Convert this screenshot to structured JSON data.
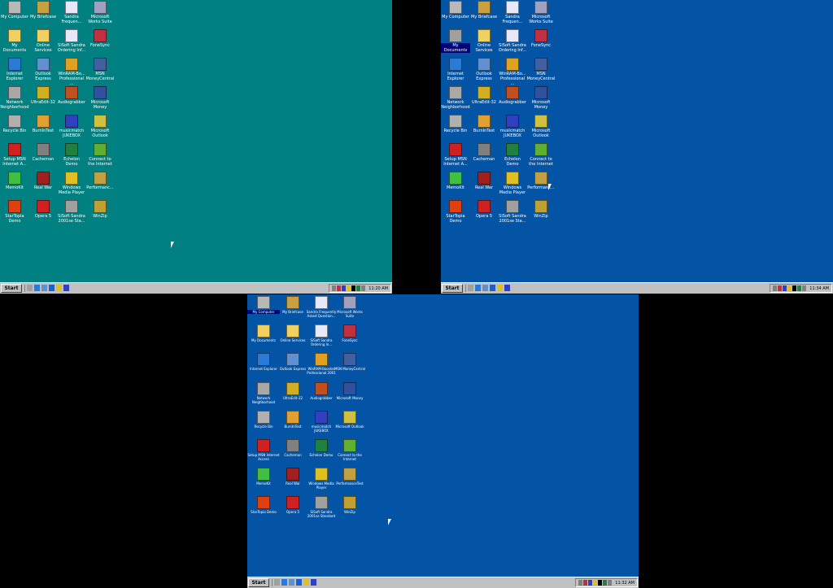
{
  "screens": [
    {
      "clock": "11:20 AM",
      "start_label": "Start",
      "icons": [
        {
          "label": "My Computer",
          "icon": "computer-icon",
          "color": "#b8b8b8"
        },
        {
          "label": "My Briefcase",
          "icon": "briefcase-icon",
          "color": "#c8a040"
        },
        {
          "label": "Sandra Frequen...",
          "icon": "document-icon",
          "color": "#e8e8f8"
        },
        {
          "label": "Microsoft Works Suite",
          "icon": "works-icon",
          "color": "#a0a0c0"
        },
        {
          "label": "My Documents",
          "icon": "folder-icon",
          "color": "#f0d060"
        },
        {
          "label": "Online Services",
          "icon": "folder-icon",
          "color": "#f0d060"
        },
        {
          "label": "SiSoft Sandra Ordering Inf...",
          "icon": "document-icon",
          "color": "#e8e8f8"
        },
        {
          "label": "FoneSync",
          "icon": "fonesync-icon",
          "color": "#c03040"
        },
        {
          "label": "Internet Explorer",
          "icon": "ie-icon",
          "color": "#2a7ad8"
        },
        {
          "label": "Outlook Express",
          "icon": "outlook-express-icon",
          "color": "#6090d0"
        },
        {
          "label": "WinRAM-Bo... Professional ...",
          "icon": "winram-icon",
          "color": "#e0a020"
        },
        {
          "label": "MSN MoneyCentral",
          "icon": "msn-money-icon",
          "color": "#4060a0"
        },
        {
          "label": "Network Neighborhood",
          "icon": "network-icon",
          "color": "#a8a8a8"
        },
        {
          "label": "UltraEdit-32",
          "icon": "ultraedit-icon",
          "color": "#d0b020"
        },
        {
          "label": "Audiograbber",
          "icon": "audiograbber-icon",
          "color": "#c05020"
        },
        {
          "label": "Microsoft Money",
          "icon": "money-icon",
          "color": "#3050a0"
        },
        {
          "label": "Recycle Bin",
          "icon": "recycle-bin-icon",
          "color": "#b0b0b0"
        },
        {
          "label": "BurnInTest",
          "icon": "burnintest-icon",
          "color": "#e0a030"
        },
        {
          "label": "musicmatch JUKEBOX",
          "icon": "musicmatch-icon",
          "color": "#3040c0"
        },
        {
          "label": "Microsoft Outlook",
          "icon": "outlook-icon",
          "color": "#d0c040"
        },
        {
          "label": "Setup MSN Internet A...",
          "icon": "msn-icon",
          "color": "#d02020"
        },
        {
          "label": "Cacheman",
          "icon": "cacheman-icon",
          "color": "#808080"
        },
        {
          "label": "Echelon Demo",
          "icon": "echelon-icon",
          "color": "#208040"
        },
        {
          "label": "Connect to the Internet",
          "icon": "connect-icon",
          "color": "#60b030"
        },
        {
          "label": "MemoKit",
          "icon": "memokit-icon",
          "color": "#40c040"
        },
        {
          "label": "Real War",
          "icon": "realwar-icon",
          "color": "#a02020"
        },
        {
          "label": "Windows Media Player",
          "icon": "media-player-icon",
          "color": "#e0c020"
        },
        {
          "label": "Performanc...",
          "icon": "performance-icon",
          "color": "#c0a040"
        },
        {
          "label": "StarTopia Demo",
          "icon": "startopia-icon",
          "color": "#e04010"
        },
        {
          "label": "Opera 5",
          "icon": "opera-icon",
          "color": "#d02020"
        },
        {
          "label": "SiSoft Sandra 2001se Sta...",
          "icon": "sandra-icon",
          "color": "#a0a0a0"
        },
        {
          "label": "WinZip",
          "icon": "winzip-icon",
          "color": "#c0a030"
        }
      ]
    },
    {
      "clock": "11:34 AM",
      "start_label": "Start",
      "icons": [
        {
          "label": "My Computer",
          "icon": "computer-icon",
          "color": "#b8b8b8"
        },
        {
          "label": "My Briefcase",
          "icon": "briefcase-icon",
          "color": "#c8a040"
        },
        {
          "label": "Sandra Frequen...",
          "icon": "document-icon",
          "color": "#e8e8f8"
        },
        {
          "label": "Microsoft Works Suite",
          "icon": "works-icon",
          "color": "#a0a0c0"
        },
        {
          "label": "My Documents",
          "icon": "folder-icon",
          "color": "#a0a0a0",
          "selected": true
        },
        {
          "label": "Online Services",
          "icon": "folder-icon",
          "color": "#f0d060"
        },
        {
          "label": "SiSoft Sandra Ordering Inf...",
          "icon": "document-icon",
          "color": "#e8e8f8"
        },
        {
          "label": "FoneSync",
          "icon": "fonesync-icon",
          "color": "#c03040"
        },
        {
          "label": "Internet Explorer",
          "icon": "ie-icon",
          "color": "#2a7ad8"
        },
        {
          "label": "Outlook Express",
          "icon": "outlook-express-icon",
          "color": "#6090d0"
        },
        {
          "label": "WinRAM-Bo... Professional ...",
          "icon": "winram-icon",
          "color": "#e0a020"
        },
        {
          "label": "MSN MoneyCentral",
          "icon": "msn-money-icon",
          "color": "#4060a0"
        },
        {
          "label": "Network Neighborhood",
          "icon": "network-icon",
          "color": "#a8a8a8"
        },
        {
          "label": "UltraEdit-32",
          "icon": "ultraedit-icon",
          "color": "#d0b020"
        },
        {
          "label": "Audiograbber",
          "icon": "audiograbber-icon",
          "color": "#c05020"
        },
        {
          "label": "Microsoft Money",
          "icon": "money-icon",
          "color": "#3050a0"
        },
        {
          "label": "Recycle Bin",
          "icon": "recycle-bin-icon",
          "color": "#b0b0b0"
        },
        {
          "label": "BurnInTest",
          "icon": "burnintest-icon",
          "color": "#e0a030"
        },
        {
          "label": "musicmatch JUKEBOX",
          "icon": "musicmatch-icon",
          "color": "#3040c0"
        },
        {
          "label": "Microsoft Outlook",
          "icon": "outlook-icon",
          "color": "#d0c040"
        },
        {
          "label": "Setup MSN Internet A...",
          "icon": "msn-icon",
          "color": "#d02020"
        },
        {
          "label": "Cacheman",
          "icon": "cacheman-icon",
          "color": "#808080"
        },
        {
          "label": "Echelon Demo",
          "icon": "echelon-icon",
          "color": "#208040"
        },
        {
          "label": "Connect to the Internet",
          "icon": "connect-icon",
          "color": "#60b030"
        },
        {
          "label": "MemoKit",
          "icon": "memokit-icon",
          "color": "#40c040"
        },
        {
          "label": "Real War",
          "icon": "realwar-icon",
          "color": "#a02020"
        },
        {
          "label": "Windows Media Player",
          "icon": "media-player-icon",
          "color": "#e0c020"
        },
        {
          "label": "Performanc...",
          "icon": "performance-icon",
          "color": "#c0a040"
        },
        {
          "label": "StarTopia Demo",
          "icon": "startopia-icon",
          "color": "#e04010"
        },
        {
          "label": "Opera 5",
          "icon": "opera-icon",
          "color": "#d02020"
        },
        {
          "label": "SiSoft Sandra 2001se Sta...",
          "icon": "sandra-icon",
          "color": "#a0a0a0"
        },
        {
          "label": "WinZip",
          "icon": "winzip-icon",
          "color": "#c0a030"
        }
      ]
    },
    {
      "clock": "11:32 AM",
      "start_label": "Start",
      "icons": [
        {
          "label": "My Computer",
          "icon": "computer-icon",
          "color": "#b8b8b8",
          "selected": true
        },
        {
          "label": "My Briefcase",
          "icon": "briefcase-icon",
          "color": "#c8a040"
        },
        {
          "label": "Sandra Frequently Asked Question...",
          "icon": "document-icon",
          "color": "#e8e8f8"
        },
        {
          "label": "Microsoft Works Suite",
          "icon": "works-icon",
          "color": "#a0a0c0"
        },
        {
          "label": "My Documents",
          "icon": "folder-icon",
          "color": "#f0d060"
        },
        {
          "label": "Online Services",
          "icon": "folder-icon",
          "color": "#f0d060"
        },
        {
          "label": "SiSoft Sandra Ordering In...",
          "icon": "document-icon",
          "color": "#e8e8f8"
        },
        {
          "label": "FoneSync",
          "icon": "fonesync-icon",
          "color": "#c03040"
        },
        {
          "label": "Internet Explorer",
          "icon": "ie-icon",
          "color": "#2a7ad8"
        },
        {
          "label": "Outlook Express",
          "icon": "outlook-express-icon",
          "color": "#6090d0"
        },
        {
          "label": "WinRAM-Booster Professional 2001",
          "icon": "winram-icon",
          "color": "#e0a020"
        },
        {
          "label": "MSN MoneyCentral",
          "icon": "msn-money-icon",
          "color": "#4060a0"
        },
        {
          "label": "Network Neighborhood",
          "icon": "network-icon",
          "color": "#a8a8a8"
        },
        {
          "label": "UltraEdit-32",
          "icon": "ultraedit-icon",
          "color": "#d0b020"
        },
        {
          "label": "Audiograbber",
          "icon": "audiograbber-icon",
          "color": "#c05020"
        },
        {
          "label": "Microsoft Money",
          "icon": "money-icon",
          "color": "#3050a0"
        },
        {
          "label": "Recycle Bin",
          "icon": "recycle-bin-icon",
          "color": "#b0b0b0"
        },
        {
          "label": "BurnInTest",
          "icon": "burnintest-icon",
          "color": "#e0a030"
        },
        {
          "label": "musicmatch JUKEBOX",
          "icon": "musicmatch-icon",
          "color": "#3040c0"
        },
        {
          "label": "Microsoft Outlook",
          "icon": "outlook-icon",
          "color": "#d0c040"
        },
        {
          "label": "Setup MSN Internet Access",
          "icon": "msn-icon",
          "color": "#d02020"
        },
        {
          "label": "Cacheman",
          "icon": "cacheman-icon",
          "color": "#808080"
        },
        {
          "label": "Echelon Demo",
          "icon": "echelon-icon",
          "color": "#208040"
        },
        {
          "label": "Connect to the Internet",
          "icon": "connect-icon",
          "color": "#60b030"
        },
        {
          "label": "MemoKit",
          "icon": "memokit-icon",
          "color": "#40c040"
        },
        {
          "label": "Real War",
          "icon": "realwar-icon",
          "color": "#a02020"
        },
        {
          "label": "Windows Media Player",
          "icon": "media-player-icon",
          "color": "#e0c020"
        },
        {
          "label": "PerformanceTest",
          "icon": "performance-icon",
          "color": "#c0a040"
        },
        {
          "label": "StarTopia Demo",
          "icon": "startopia-icon",
          "color": "#e04010"
        },
        {
          "label": "Opera 5",
          "icon": "opera-icon",
          "color": "#d02020"
        },
        {
          "label": "SiSoft Sandra 2001se Standard",
          "icon": "sandra-icon",
          "color": "#a0a0a0"
        },
        {
          "label": "WinZip",
          "icon": "winzip-icon",
          "color": "#c0a030"
        }
      ]
    }
  ]
}
